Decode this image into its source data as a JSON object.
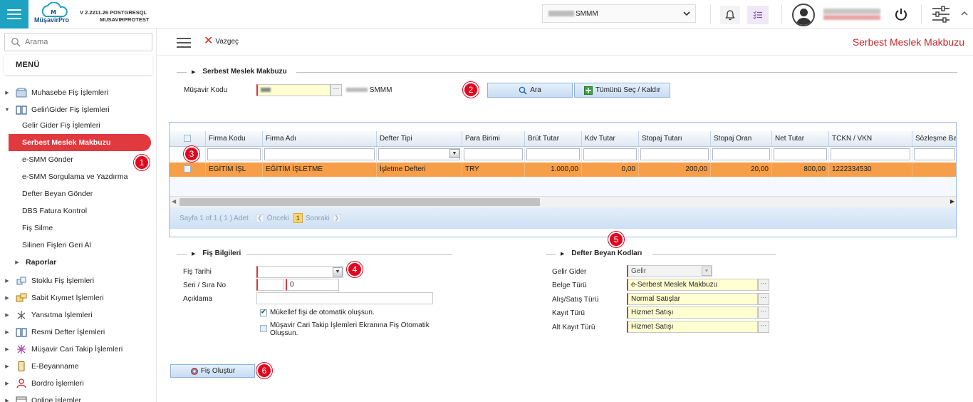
{
  "app": {
    "logo_text": "MüşavirPro",
    "version": "V 2.2211.26 POSTGRESQL",
    "db": "MUSAVIRPROTEST",
    "company_select": "SMMM"
  },
  "sidebar": {
    "search_placeholder": "Arama",
    "menu_title": "MENÜ",
    "items": [
      {
        "label": "Muhasebe Fiş İşlemleri"
      },
      {
        "label": "Gelir\\Gider Fiş İşlemleri"
      },
      {
        "label": "Gelir Gider Fiş İşlemleri"
      },
      {
        "label": "Serbest Meslek Makbuzu"
      },
      {
        "label": "e-SMM Gönder"
      },
      {
        "label": "e-SMM Sorgulama ve Yazdırma"
      },
      {
        "label": "Defter Beyan Gönder"
      },
      {
        "label": "DBS Fatura Kontrol"
      },
      {
        "label": "Fiş Silme"
      },
      {
        "label": "Silinen Fişleri Geri Al"
      },
      {
        "label": "Raporlar"
      },
      {
        "label": "Stoklu Fiş İşlemleri"
      },
      {
        "label": "Sabit Kıymet İşlemleri"
      },
      {
        "label": "Yansıtma İşlemleri"
      },
      {
        "label": "Resmi Defter İşlemleri"
      },
      {
        "label": "Müşavir Cari Takip İşlemleri"
      },
      {
        "label": "E-Beyanname"
      },
      {
        "label": "Bordro İşlemleri"
      },
      {
        "label": "Online İşlemler"
      }
    ]
  },
  "toolbar": {
    "cancel_label": "Vazgeç",
    "page_title": "Serbest Meslek Makbuzu"
  },
  "section1": {
    "legend": "Serbest Meslek Makbuzu",
    "musavir_label": "Müşavir Kodu",
    "musavir_name": "SMMM",
    "search_button": "Ara",
    "select_all_button": "Tümünü Seç / Kaldır"
  },
  "grid": {
    "columns": [
      "Firma Kodu",
      "Firma Adı",
      "Defter Tipi",
      "Para Birimi",
      "Brüt Tutar",
      "Kdv Tutar",
      "Stopaj Tutarı",
      "Stopaj Oran",
      "Net Tutar",
      "TCKN / VKN",
      "Sözleşme Ba"
    ],
    "rows": [
      {
        "firma_kodu": "EGİTİM İŞL",
        "firma_adi": "EĞİTİM İŞLETME",
        "defter_tipi": "İşletme Defteri",
        "para_birimi": "TRY",
        "brut": "1.000,00",
        "kdv": "0,00",
        "stopaj_tutari": "200,00",
        "stopaj_oran": "20,00",
        "net": "800,00",
        "tckn": "1222334530",
        "sozlesme": ""
      }
    ],
    "pager": {
      "info": "Sayfa 1 of 1 ( 1 ) Adet",
      "prev": "Önceki",
      "current": "1",
      "next": "Sonraki"
    }
  },
  "fis": {
    "legend": "Fiş Bilgileri",
    "tarih_label": "Fiş Tarihi",
    "seri_label": "Seri / Sıra No",
    "sira_value": "0",
    "aciklama_label": "Açıklama",
    "check1": "Mükellef fişi de otomatik oluşsun.",
    "check2_line1": "Müşavir Cari Takip İşlemleri Ekranına Fiş Otomatik",
    "check2_line2": "Oluşsun.",
    "create_button": "Fiş Oluştur"
  },
  "defter": {
    "legend": "Defter Beyan Kodları",
    "gelir_gider_label": "Gelir Gider",
    "gelir_gider_value": "Gelir",
    "belge_label": "Belge Türü",
    "belge_value": "e-Serbest Meslek Makbuzu",
    "alis_label": "Alış/Satış Türü",
    "alis_value": "Normal Satışlar",
    "kayit_label": "Kayıt Türü",
    "kayit_value": "Hizmet Satışı",
    "alt_kayit_label": "Alt Kayıt Türü",
    "alt_kayit_value": "Hizmet Satışı"
  },
  "badges": [
    "1",
    "2",
    "3",
    "4",
    "5",
    "6"
  ],
  "colors": {
    "accent": "#1ea2c2",
    "active_menu": "#e0393e",
    "selected_row": "#f79e48",
    "title_red": "#c8262b",
    "badge_red": "#e0081e"
  }
}
